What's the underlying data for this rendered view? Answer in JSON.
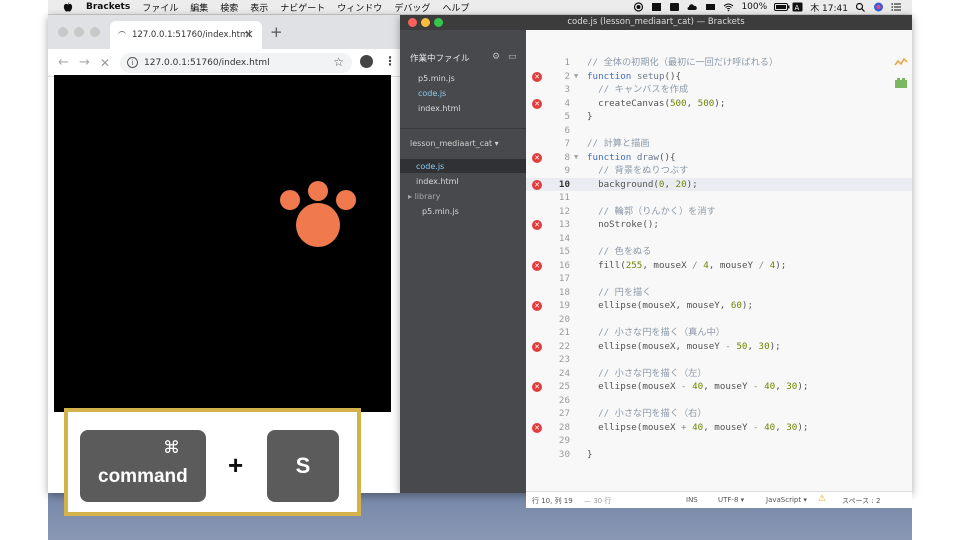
{
  "menubar": {
    "app": "Brackets",
    "items": [
      "ファイル",
      "編集",
      "検索",
      "表示",
      "ナビゲート",
      "ウィンドウ",
      "デバッグ",
      "ヘルプ"
    ],
    "battery": "100%",
    "clock": "木 17:41"
  },
  "browser": {
    "tab_title": "127.0.0.1:51760/index.html",
    "url": "127.0.0.1:51760/index.html",
    "paw_color": "#f07a4e"
  },
  "overlay": {
    "cmd_glyph": "⌘",
    "cmd_label": "command",
    "plus": "+",
    "key": "S"
  },
  "brackets": {
    "window_title": "code.js (lesson_mediaart_cat) — Brackets",
    "working_files_header": "作業中ファイル",
    "working_files": [
      "p5.min.js",
      "code.js",
      "index.html"
    ],
    "project_name": "lesson_mediaart_cat",
    "project_files": [
      "code.js",
      "index.html"
    ],
    "folder": "library",
    "folder_files": [
      "p5.min.js"
    ],
    "active_line": 10,
    "error_lines": [
      2,
      4,
      8,
      10,
      13,
      16,
      19,
      22,
      25,
      28
    ],
    "fold_lines": [
      2,
      8
    ],
    "code_lines": [
      [
        [
          "c-com",
          "// 全体の初期化（最初に一回だけ呼ばれる）"
        ]
      ],
      [
        [
          "c-kw",
          "function"
        ],
        [
          "c-id",
          " "
        ],
        [
          "c-fn",
          "setup"
        ],
        [
          "c-id",
          "(){"
        ]
      ],
      [
        [
          "c-id",
          "  "
        ],
        [
          "c-com",
          "// キャンバスを作成"
        ]
      ],
      [
        [
          "c-id",
          "  createCanvas("
        ],
        [
          "c-num",
          "500"
        ],
        [
          "c-id",
          ", "
        ],
        [
          "c-num",
          "500"
        ],
        [
          "c-id",
          ");"
        ]
      ],
      [
        [
          "c-id",
          "}"
        ]
      ],
      [
        [
          "c-id",
          ""
        ]
      ],
      [
        [
          "c-com",
          "// 計算と描画"
        ]
      ],
      [
        [
          "c-kw",
          "function"
        ],
        [
          "c-id",
          " "
        ],
        [
          "c-fn",
          "draw"
        ],
        [
          "c-id",
          "(){"
        ]
      ],
      [
        [
          "c-id",
          "  "
        ],
        [
          "c-com",
          "// 背景をぬりつぶす"
        ]
      ],
      [
        [
          "c-id",
          "  background("
        ],
        [
          "c-num",
          "0"
        ],
        [
          "c-id",
          ", "
        ],
        [
          "c-num",
          "20"
        ],
        [
          "c-id",
          ");"
        ]
      ],
      [
        [
          "c-id",
          ""
        ]
      ],
      [
        [
          "c-id",
          "  "
        ],
        [
          "c-com",
          "// 輪郭（りんかく）を消す"
        ]
      ],
      [
        [
          "c-id",
          "  noStroke();"
        ]
      ],
      [
        [
          "c-id",
          ""
        ]
      ],
      [
        [
          "c-id",
          "  "
        ],
        [
          "c-com",
          "// 色をぬる"
        ]
      ],
      [
        [
          "c-id",
          "  fill("
        ],
        [
          "c-num",
          "255"
        ],
        [
          "c-id",
          ", mouseX "
        ],
        [
          "c-op",
          "/"
        ],
        [
          "c-id",
          " "
        ],
        [
          "c-num",
          "4"
        ],
        [
          "c-id",
          ", mouseY "
        ],
        [
          "c-op",
          "/"
        ],
        [
          "c-id",
          " "
        ],
        [
          "c-num",
          "4"
        ],
        [
          "c-id",
          ");"
        ]
      ],
      [
        [
          "c-id",
          ""
        ]
      ],
      [
        [
          "c-id",
          "  "
        ],
        [
          "c-com",
          "// 円を描く"
        ]
      ],
      [
        [
          "c-id",
          "  ellipse(mouseX, mouseY, "
        ],
        [
          "c-num",
          "60"
        ],
        [
          "c-id",
          ");"
        ]
      ],
      [
        [
          "c-id",
          ""
        ]
      ],
      [
        [
          "c-id",
          "  "
        ],
        [
          "c-com",
          "// 小さな円を描く（真ん中）"
        ]
      ],
      [
        [
          "c-id",
          "  ellipse(mouseX, mouseY "
        ],
        [
          "c-op",
          "-"
        ],
        [
          "c-id",
          " "
        ],
        [
          "c-num",
          "50"
        ],
        [
          "c-id",
          ", "
        ],
        [
          "c-num",
          "30"
        ],
        [
          "c-id",
          ");"
        ]
      ],
      [
        [
          "c-id",
          ""
        ]
      ],
      [
        [
          "c-id",
          "  "
        ],
        [
          "c-com",
          "// 小さな円を描く（左）"
        ]
      ],
      [
        [
          "c-id",
          "  ellipse(mouseX "
        ],
        [
          "c-op",
          "-"
        ],
        [
          "c-id",
          " "
        ],
        [
          "c-num",
          "40"
        ],
        [
          "c-id",
          ", mouseY "
        ],
        [
          "c-op",
          "-"
        ],
        [
          "c-id",
          " "
        ],
        [
          "c-num",
          "40"
        ],
        [
          "c-id",
          ", "
        ],
        [
          "c-num",
          "30"
        ],
        [
          "c-id",
          ");"
        ]
      ],
      [
        [
          "c-id",
          ""
        ]
      ],
      [
        [
          "c-id",
          "  "
        ],
        [
          "c-com",
          "// 小さな円を描く（右）"
        ]
      ],
      [
        [
          "c-id",
          "  ellipse(mouseX "
        ],
        [
          "c-op",
          "+"
        ],
        [
          "c-id",
          " "
        ],
        [
          "c-num",
          "40"
        ],
        [
          "c-id",
          ", mouseY "
        ],
        [
          "c-op",
          "-"
        ],
        [
          "c-id",
          " "
        ],
        [
          "c-num",
          "40"
        ],
        [
          "c-id",
          ", "
        ],
        [
          "c-num",
          "30"
        ],
        [
          "c-id",
          ");"
        ]
      ],
      [
        [
          "c-id",
          ""
        ]
      ],
      [
        [
          "c-id",
          "}"
        ]
      ]
    ],
    "status": {
      "position": "行 10, 列 19",
      "lines": "— 30 行",
      "ins": "INS",
      "encoding": "UTF-8 ▾",
      "language": "JavaScript ▾",
      "warning": "⚠",
      "spaces": "スペース : 2"
    }
  }
}
